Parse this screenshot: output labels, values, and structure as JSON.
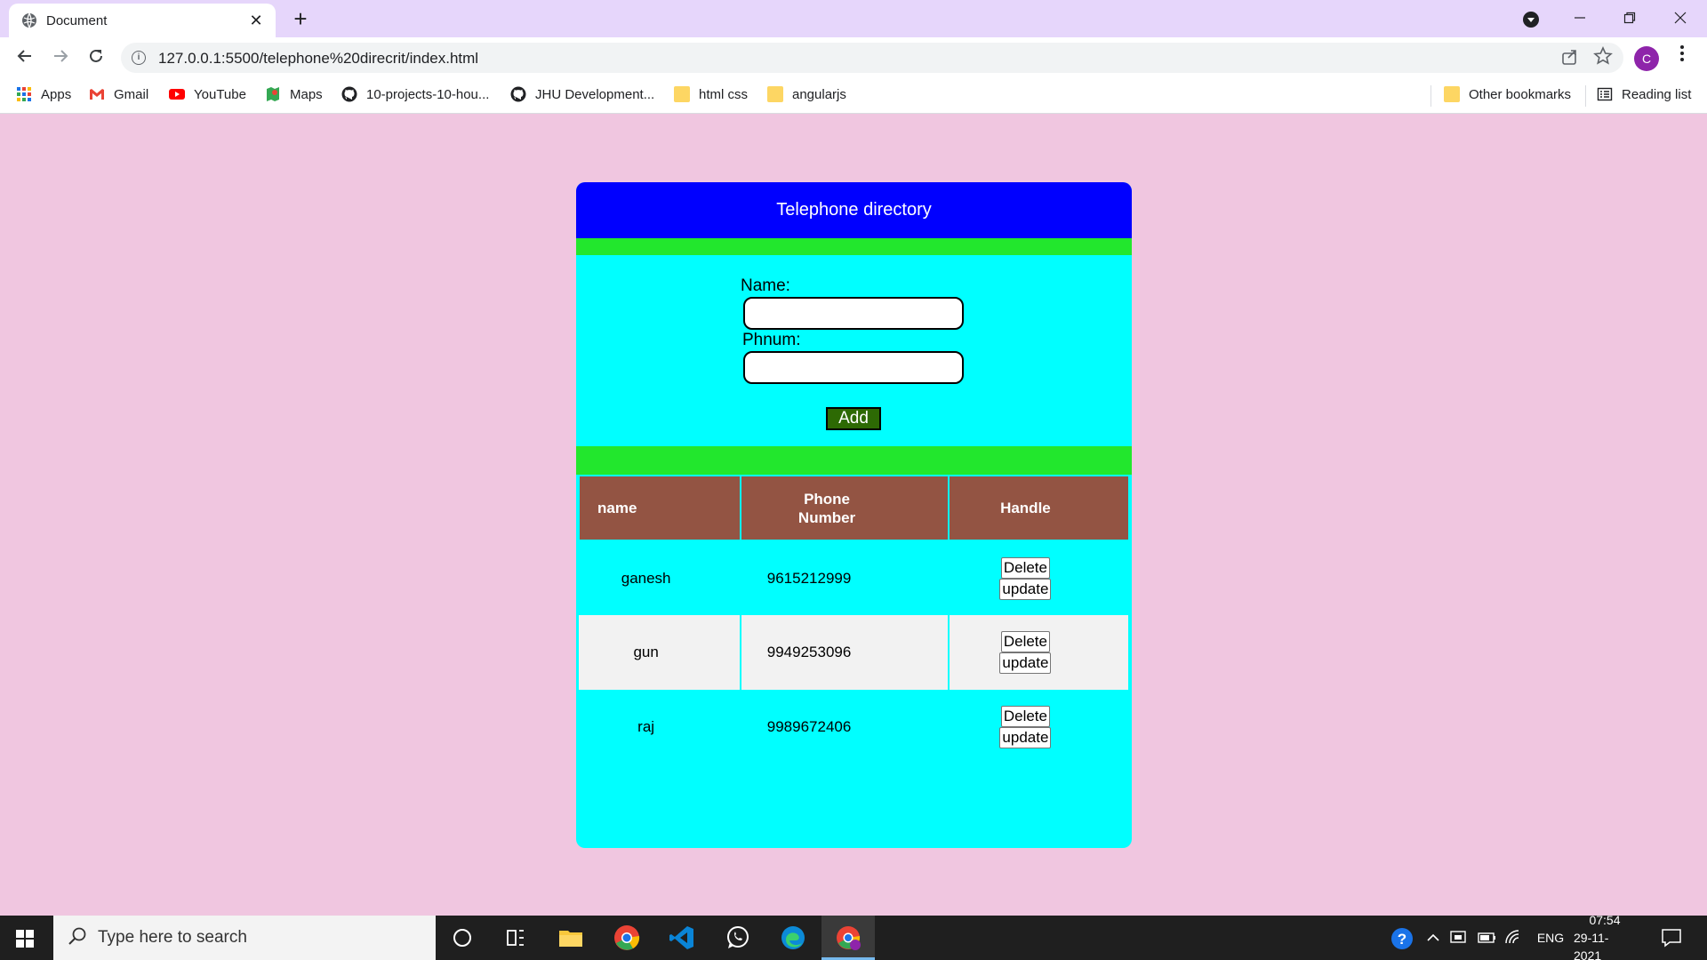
{
  "browser": {
    "tab_title": "Document",
    "tab_close": "✕",
    "new_tab": "+",
    "url": "127.0.0.1:5500/telephone%20direcrit/index.html",
    "profile_initial": "C",
    "bookmarks": [
      {
        "label": "Apps"
      },
      {
        "label": "Gmail"
      },
      {
        "label": "YouTube"
      },
      {
        "label": "Maps"
      },
      {
        "label": "10-projects-10-hou..."
      },
      {
        "label": "JHU Development..."
      },
      {
        "label": "html css"
      },
      {
        "label": "angularjs"
      }
    ],
    "other_bookmarks": "Other bookmarks",
    "reading_list": "Reading list"
  },
  "app": {
    "header": "Telephone directory",
    "name_label": "Name:",
    "phone_label": "Phnum:",
    "name_value": "",
    "phone_value": "",
    "add_label": "Add",
    "table": {
      "headers": [
        "name",
        "Phone Number",
        "Handle"
      ],
      "rows": [
        {
          "name": "ganesh",
          "phone": "9615212999"
        },
        {
          "name": "gun",
          "phone": "9949253096"
        },
        {
          "name": "raj",
          "phone": "9989672406"
        }
      ],
      "delete_label": "Delete",
      "update_label": "update"
    },
    "colors": {
      "page_bg": "#f0c6e0",
      "card_bg": "#00ffff",
      "header_bg": "#0000ff",
      "green_bar": "#22e72d",
      "table_header_bg": "#935443",
      "add_button_bg": "#2d6a04"
    }
  },
  "taskbar": {
    "search_placeholder": "Type here to search",
    "language": "ENG",
    "time": "07:54",
    "date": "29-11-2021"
  }
}
